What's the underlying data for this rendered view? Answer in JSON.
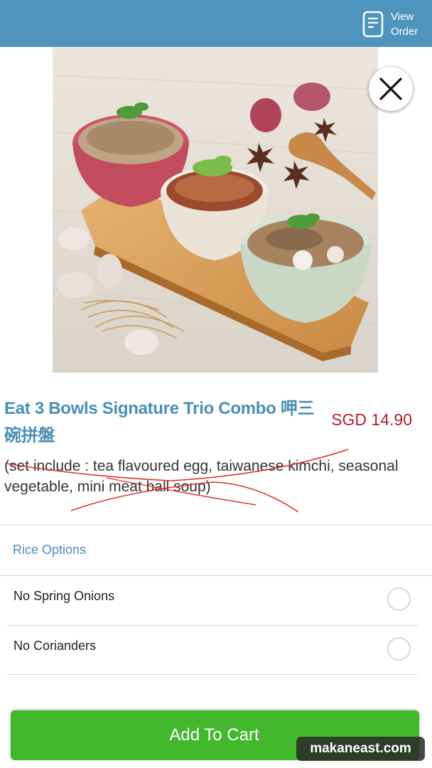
{
  "header": {
    "view_order_line1": "View",
    "view_order_line2": "Order",
    "icon": "document-icon"
  },
  "product": {
    "title": "Eat 3 Bowls Signature Trio Combo 呷三碗拼盤",
    "price": "SGD 14.90",
    "description": "(set include : tea flavoured egg, taiwanese kimchi, seasonal vegetable, mini meat ball soup)",
    "image_icon": "food-photo",
    "close_icon": "close-icon"
  },
  "options": {
    "group_title": "Rice Options",
    "items": [
      {
        "label": "No Spring Onions",
        "selected": false
      },
      {
        "label": "No Corianders",
        "selected": false
      }
    ]
  },
  "cart": {
    "button_label": "Add To Cart"
  },
  "watermark": "makaneast.com",
  "colors": {
    "header_bg": "#4f94bd",
    "title": "#4a8fb5",
    "price": "#b3202a",
    "cart_button": "#44b82c",
    "scribble": "#e03030"
  }
}
